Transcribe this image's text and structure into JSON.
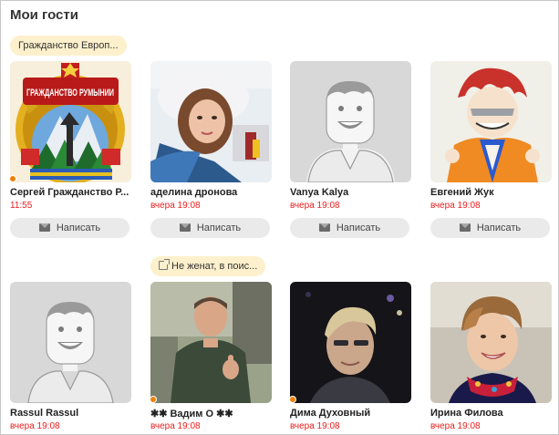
{
  "section": {
    "title": "Мои гости"
  },
  "message_label": "Написать",
  "guests": [
    {
      "name": "Сергей Гражданство Р...",
      "time": "11:55",
      "tag": "Гражданство Европ...",
      "online": true,
      "avatar": "coat-of-arms",
      "emblem_text": "ГРАЖДАНСТВО РУМЫНИИ"
    },
    {
      "name": "аделина дронова",
      "time": "вчера 19:08",
      "tag": "",
      "online": false,
      "avatar": "photo-girl-selfie"
    },
    {
      "name": "Vanya Kalya",
      "time": "вчера 19:08",
      "tag": "",
      "online": false,
      "avatar": "placeholder-avatar"
    },
    {
      "name": "Евгений Жук",
      "time": "вчера 19:08",
      "tag": "",
      "online": false,
      "avatar": "anime-drawing"
    },
    {
      "name": "Rassul Rassul",
      "time": "вчера 19:08",
      "tag": "",
      "online": false,
      "avatar": "placeholder-avatar"
    },
    {
      "name": "✱✱ Вадим О ✱✱",
      "time": "вчера 19:08",
      "tag": "Не женат, в поис...",
      "online": true,
      "avatar": "photo-man-thumbs-up"
    },
    {
      "name": "Дима Духовный",
      "time": "вчера 19:08",
      "tag": "",
      "online": true,
      "avatar": "photo-man-dark"
    },
    {
      "name": "Ирина Филова",
      "time": "вчера 19:08",
      "tag": "",
      "online": false,
      "avatar": "photo-woman-smiling"
    }
  ],
  "colors": {
    "accent_orange": "#ee8208",
    "time_red": "#ee1c1c",
    "tag_bg": "#fdf0cc",
    "button_bg": "#eaeaea"
  }
}
